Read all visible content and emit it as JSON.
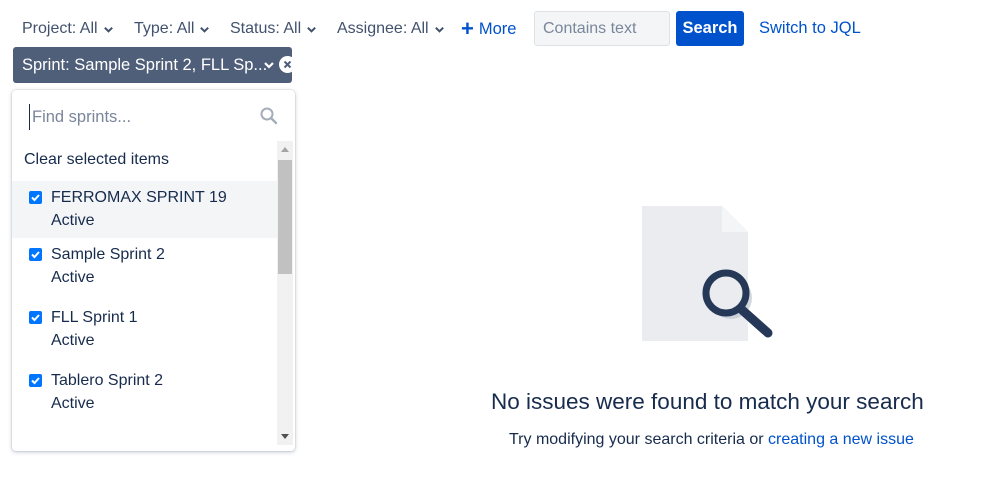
{
  "filters": {
    "project": "Project: All",
    "type": "Type: All",
    "status": "Status: All",
    "assignee": "Assignee: All",
    "more": "More",
    "text_placeholder": "Contains text",
    "search_label": "Search",
    "switch_jql": "Switch to JQL"
  },
  "sprint_filter": {
    "label": "Sprint: Sample Sprint 2, FLL Sp..."
  },
  "sprint_dropdown": {
    "search_placeholder": "Find sprints...",
    "clear_label": "Clear selected items",
    "items": [
      {
        "name": "FERROMAX SPRINT 19",
        "status": "Active",
        "checked": true
      },
      {
        "name": "Sample Sprint 2",
        "status": "Active",
        "checked": true
      },
      {
        "name": "FLL Sprint 1",
        "status": "Active",
        "checked": true
      },
      {
        "name": "Tablero Sprint 2",
        "status": "Active",
        "checked": true
      }
    ]
  },
  "empty_state": {
    "title": "No issues were found to match your search",
    "subtitle": "Try modifying your search criteria or",
    "link": "creating a new issue"
  },
  "colors": {
    "primary": "#0052cc",
    "lozenge": "#505f79",
    "text": "#172b4d"
  }
}
